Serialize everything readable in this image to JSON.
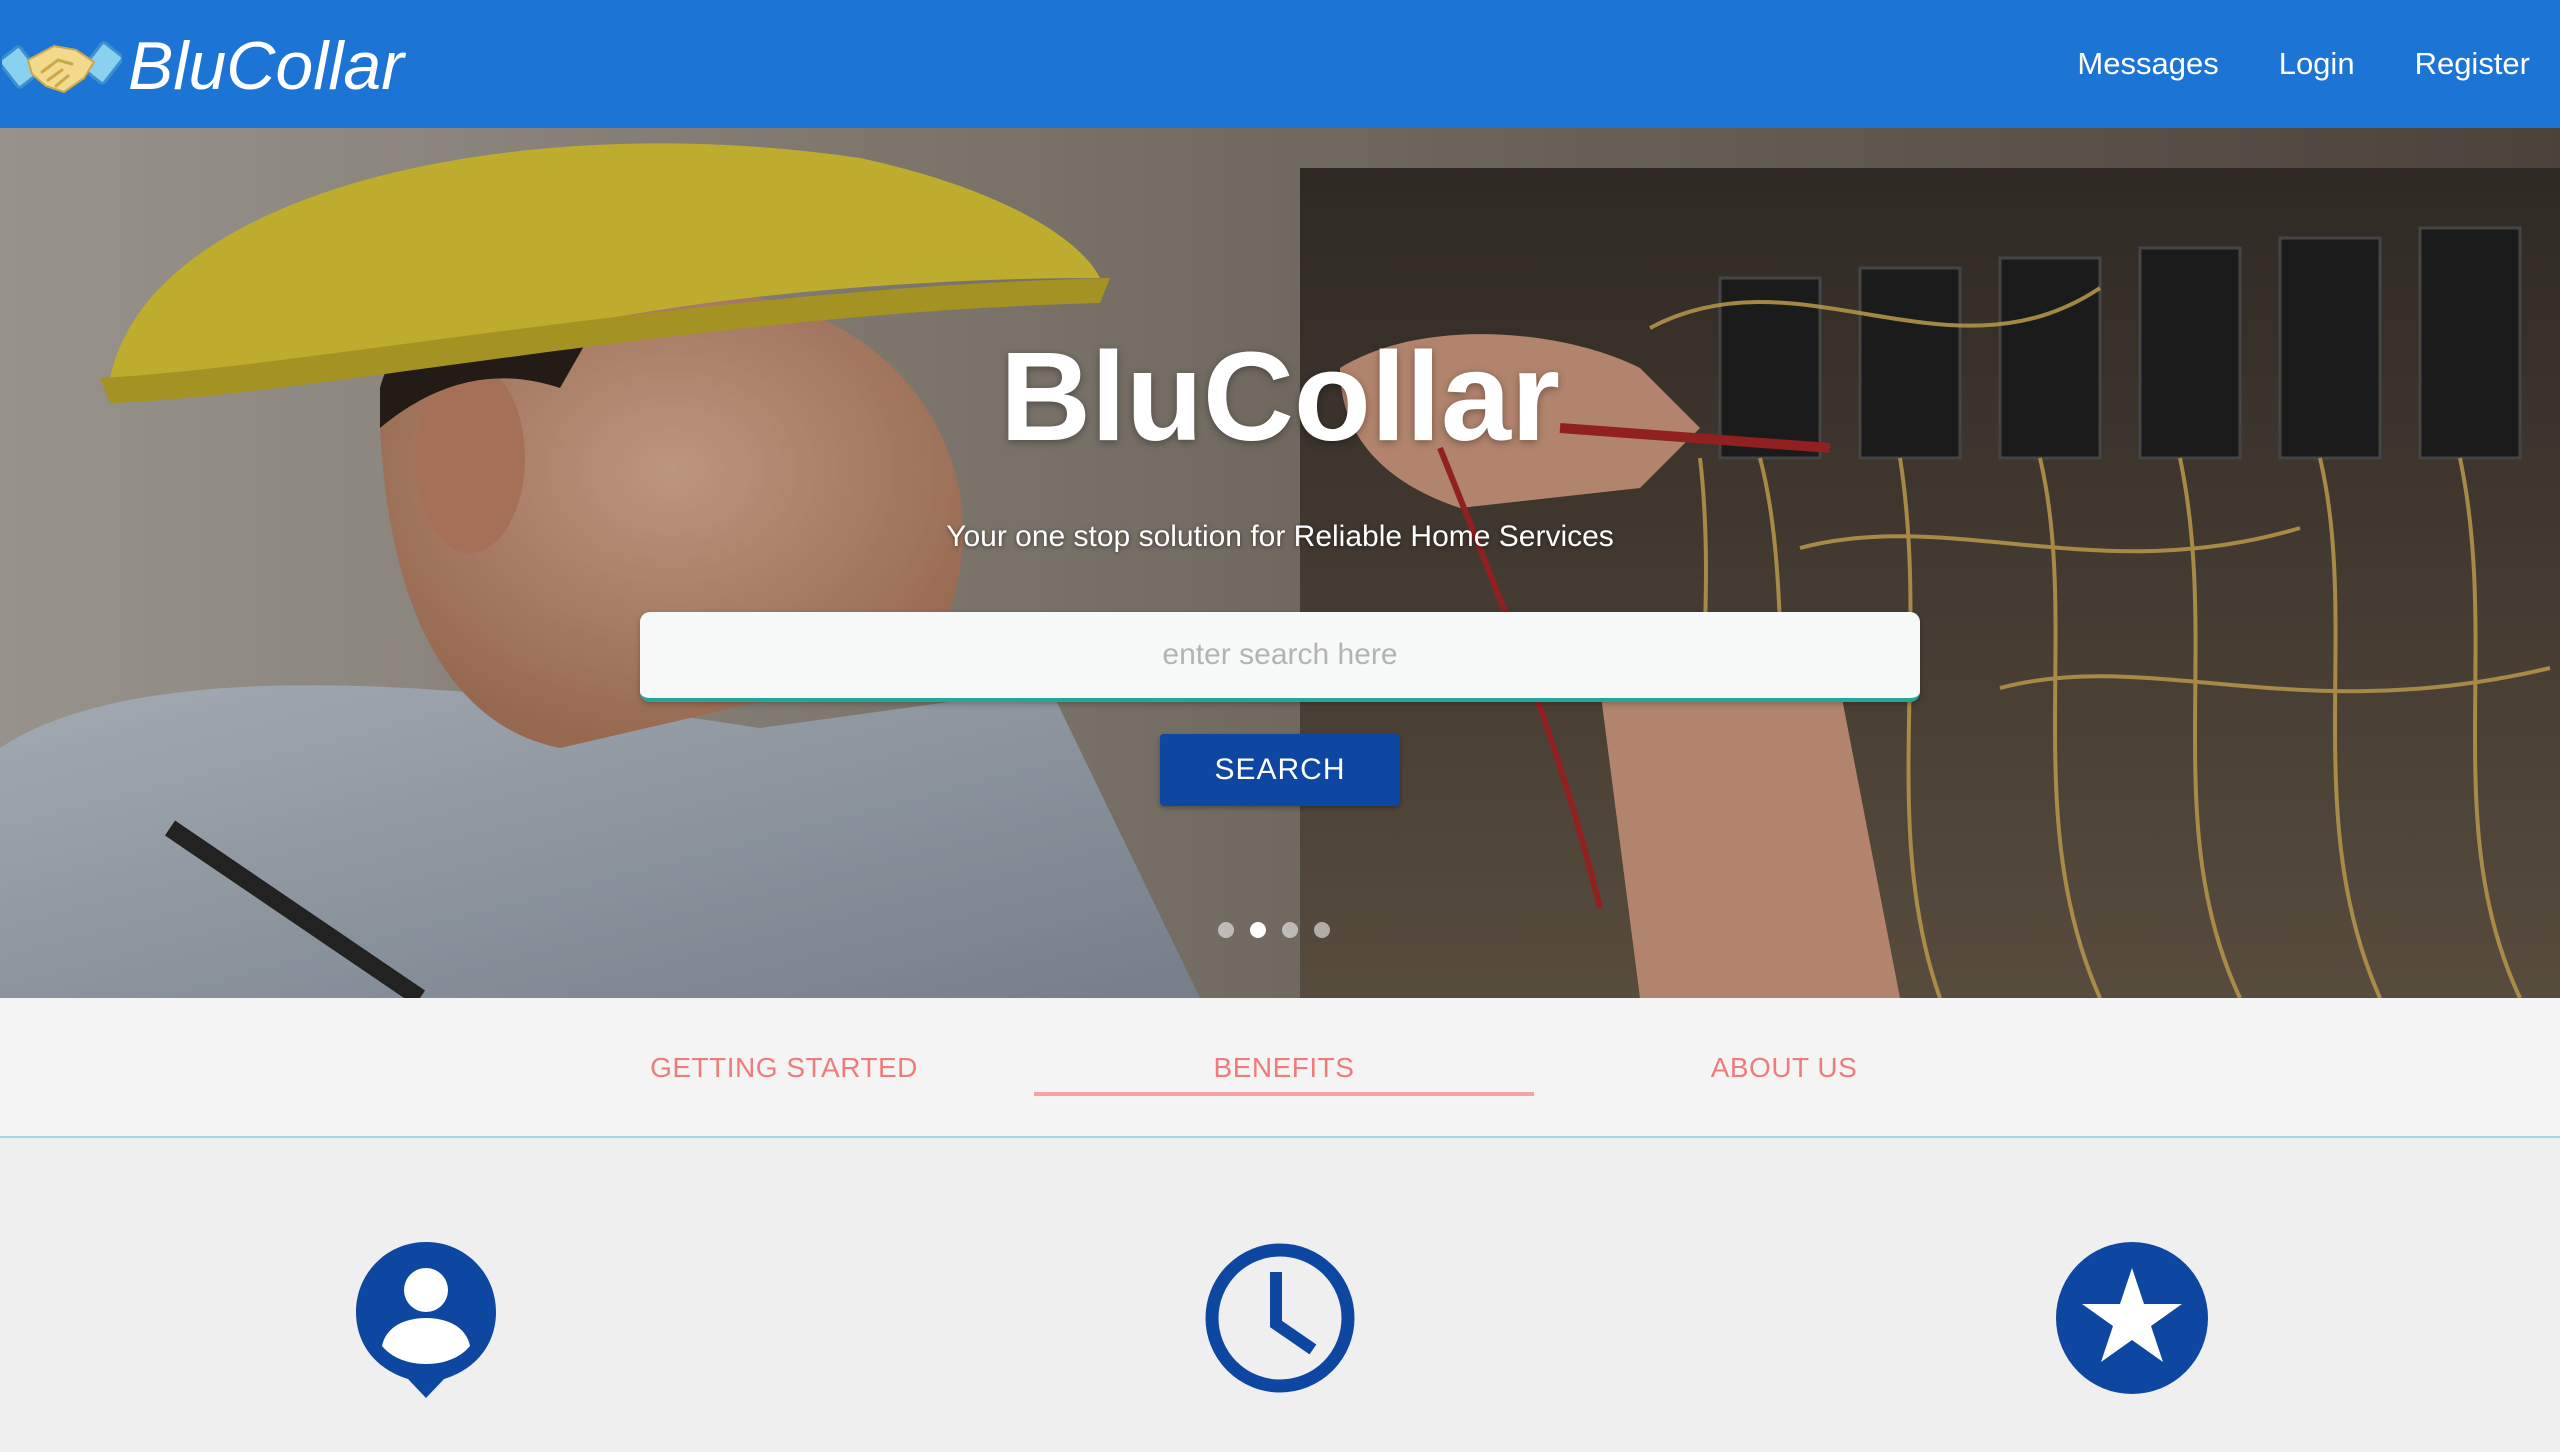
{
  "navbar": {
    "brand": "BluCollar",
    "logo_icon": "handshake-icon",
    "links": [
      "Messages",
      "Login",
      "Register"
    ]
  },
  "hero": {
    "title": "BluCollar",
    "subtitle": "Your one stop solution for Reliable Home Services",
    "search_placeholder": "enter search here",
    "search_button": "SEARCH",
    "carousel_count": 4,
    "carousel_active": 2
  },
  "tabs": {
    "items": [
      "GETTING STARTED",
      "BENEFITS",
      "ABOUT US"
    ],
    "active": "BENEFITS"
  },
  "benefits": {
    "icons": [
      "user-pin-icon",
      "clock-icon",
      "star-icon"
    ]
  },
  "colors": {
    "navbar": "#1c75d4",
    "button": "#0d47a1",
    "tab_text": "#ee7c7c",
    "icon": "#0d47a1",
    "accent_line": "#26a69a"
  }
}
